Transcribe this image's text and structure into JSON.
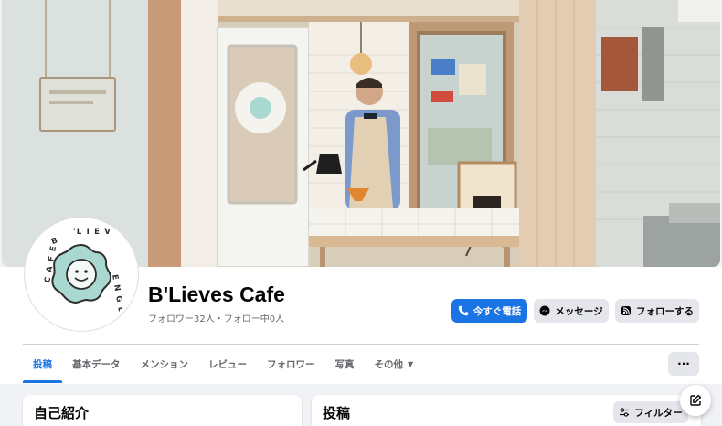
{
  "cover": {
    "description_icon": "cafe-cover-photo"
  },
  "avatar": {
    "logo_text": "B'LIEVES ENGLISH CAFE",
    "accent_color": "#a8d8cf"
  },
  "profile": {
    "name": "B'Lieves Cafe",
    "stats": "フォロワー32人・フォロー中0人"
  },
  "actions": {
    "call_label": "今すぐ電話",
    "message_label": "メッセージ",
    "follow_label": "フォローする"
  },
  "tabs": [
    {
      "label": "投稿"
    },
    {
      "label": "基本データ"
    },
    {
      "label": "メンション"
    },
    {
      "label": "レビュー"
    },
    {
      "label": "フォロワー"
    },
    {
      "label": "写真"
    },
    {
      "label": "その他"
    }
  ],
  "more_label": "···",
  "intro_card": {
    "title": "自己紹介"
  },
  "posts_card": {
    "title": "投稿",
    "filter_label": "フィルター"
  },
  "colors": {
    "brand": "#1b74e4",
    "secondary_button": "#e4e6eb",
    "page_bg": "#f0f2f5"
  }
}
